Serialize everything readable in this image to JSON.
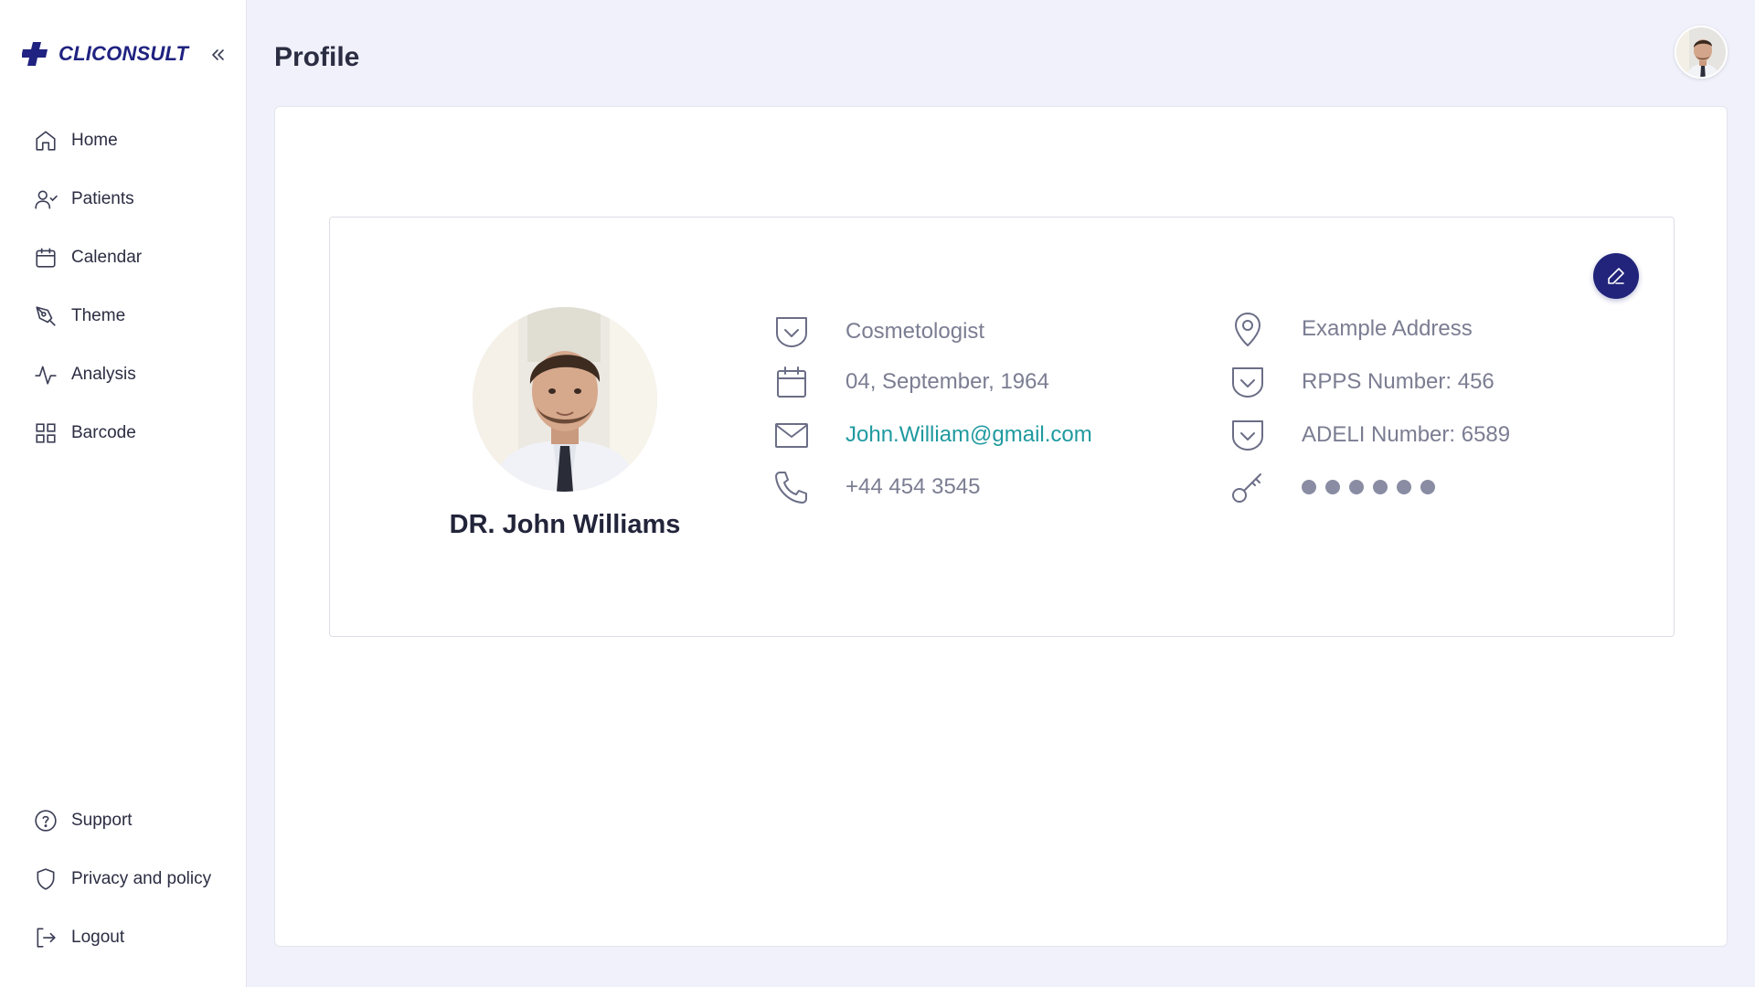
{
  "brand": {
    "name": "CLICONSULT",
    "logo_icon": "cross-logo-icon",
    "color": "#1f2280"
  },
  "sidebar": {
    "collapse_icon": "double-chevron-left-icon",
    "items": [
      {
        "label": "Home",
        "icon": "home-icon"
      },
      {
        "label": "Patients",
        "icon": "user-check-icon"
      },
      {
        "label": "Calendar",
        "icon": "calendar-icon"
      },
      {
        "label": "Theme",
        "icon": "pen-tool-icon"
      },
      {
        "label": "Analysis",
        "icon": "activity-icon"
      },
      {
        "label": "Barcode",
        "icon": "grid-icon"
      }
    ],
    "bottom_items": [
      {
        "label": "Support",
        "icon": "help-circle-icon"
      },
      {
        "label": "Privacy and policy",
        "icon": "shield-icon"
      },
      {
        "label": "Logout",
        "icon": "logout-icon"
      }
    ]
  },
  "header": {
    "title": "Profile",
    "avatar_icon": "user-avatar"
  },
  "profile": {
    "name": "DR. John Williams",
    "specialty": "Cosmetologist",
    "birth_date": "04, September, 1964",
    "email": "John.William@gmail.com",
    "phone": "+44 454 3545",
    "address": "Example Address",
    "rpps": "RPPS Number: 456",
    "adeli": "ADELI Number: 6589",
    "password_dots": 6,
    "edit_icon": "pencil-icon"
  },
  "colors": {
    "accent": "#22237a",
    "link": "#1f9aa0",
    "background": "#f0f1fa"
  }
}
